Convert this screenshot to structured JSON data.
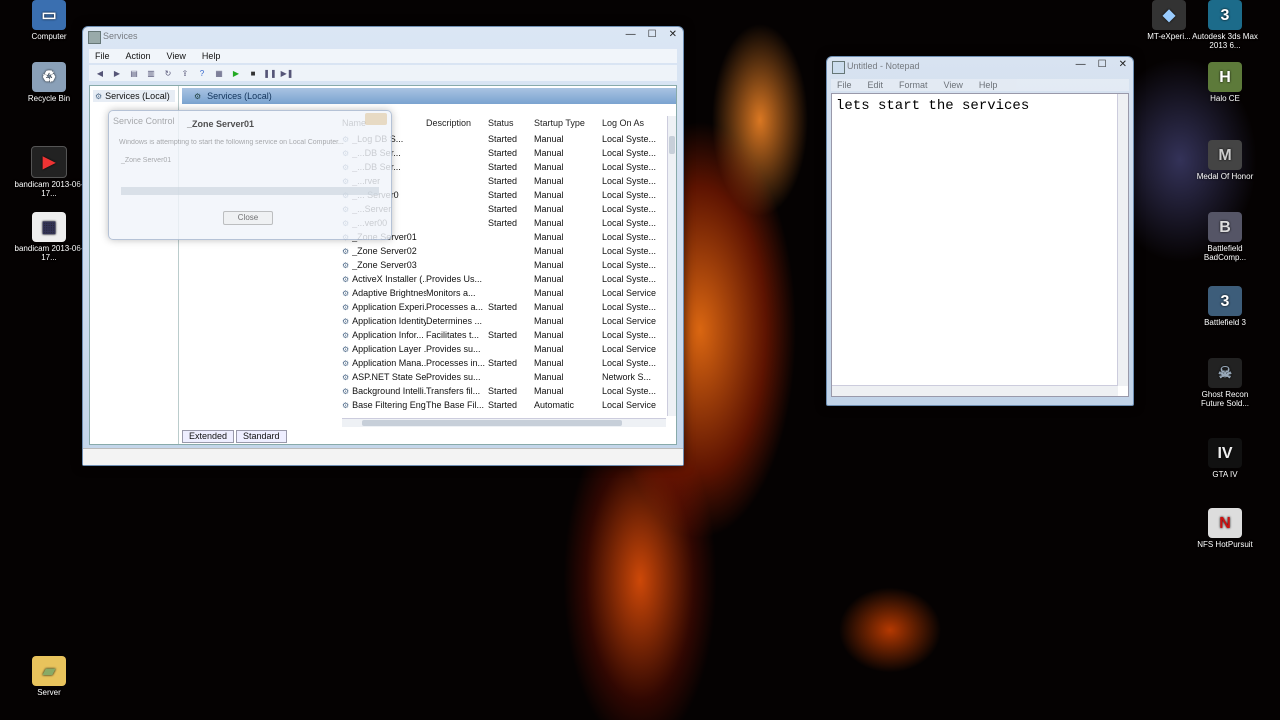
{
  "desktop": {
    "left_icons": [
      {
        "label": "Computer",
        "glyph": "▭",
        "name": "computer-icon"
      },
      {
        "label": "Recycle Bin",
        "glyph": "🗑",
        "name": "recycle-bin-icon"
      },
      {
        "label": "bandicam 2013-06-17...",
        "glyph": "▣",
        "name": "bandicam-video-icon"
      },
      {
        "label": "bandicam 2013-06-17...",
        "glyph": "▦",
        "name": "bandicam-avi-icon"
      },
      {
        "label": "Server",
        "glyph": "▰",
        "name": "folder-icon"
      }
    ],
    "right_icons": [
      {
        "label": "MT-eXperi...",
        "name": "mt-experience-icon"
      },
      {
        "label": "Autodesk 3ds Max 2013 6...",
        "name": "autodesk-3ds-max-icon"
      },
      {
        "label": "Halo CE",
        "name": "halo-ce-icon"
      },
      {
        "label": "Medal Of Honor",
        "name": "medal-of-honor-icon"
      },
      {
        "label": "Battlefield BadComp...",
        "name": "battlefield-bc-icon"
      },
      {
        "label": "Battlefield 3",
        "name": "battlefield-3-icon"
      },
      {
        "label": "Ghost Recon Future Sold...",
        "name": "ghost-recon-icon"
      },
      {
        "label": "GTA IV",
        "name": "gta-iv-icon"
      },
      {
        "label": "NFS HotPursuit",
        "name": "nfs-hot-pursuit-icon"
      }
    ]
  },
  "services": {
    "title": "Services",
    "controls": [
      "—",
      "☐",
      "✕"
    ],
    "menu": [
      "File",
      "Action",
      "View",
      "Help"
    ],
    "tree_item": "Services (Local)",
    "pane_title": "Services (Local)",
    "columns": {
      "name": "Name",
      "description": "Description",
      "status": "Status",
      "startup": "Startup Type",
      "logon": "Log On As"
    },
    "rows": [
      {
        "name": "_Log DB S...",
        "desc": "",
        "status": "Started",
        "startup": "Manual",
        "logon": "Local Syste..."
      },
      {
        "name": "_...DB Ser...",
        "desc": "",
        "status": "Started",
        "startup": "Manual",
        "logon": "Local Syste..."
      },
      {
        "name": "_...DB Ser...",
        "desc": "",
        "status": "Started",
        "startup": "Manual",
        "logon": "Local Syste..."
      },
      {
        "name": "_...rver",
        "desc": "",
        "status": "Started",
        "startup": "Manual",
        "logon": "Local Syste..."
      },
      {
        "name": "_... Server0",
        "desc": "",
        "status": "Started",
        "startup": "Manual",
        "logon": "Local Syste..."
      },
      {
        "name": "_...Server",
        "desc": "",
        "status": "Started",
        "startup": "Manual",
        "logon": "Local Syste..."
      },
      {
        "name": "_...ver00",
        "desc": "",
        "status": "Started",
        "startup": "Manual",
        "logon": "Local Syste..."
      },
      {
        "name": "_Zone Server01",
        "desc": "",
        "status": "",
        "startup": "Manual",
        "logon": "Local Syste..."
      },
      {
        "name": "_Zone Server02",
        "desc": "",
        "status": "",
        "startup": "Manual",
        "logon": "Local Syste..."
      },
      {
        "name": "_Zone Server03",
        "desc": "",
        "status": "",
        "startup": "Manual",
        "logon": "Local Syste..."
      },
      {
        "name": "ActiveX Installer (...",
        "desc": "Provides Us...",
        "status": "",
        "startup": "Manual",
        "logon": "Local Syste..."
      },
      {
        "name": "Adaptive Brightness",
        "desc": "Monitors a...",
        "status": "",
        "startup": "Manual",
        "logon": "Local Service"
      },
      {
        "name": "Application Experi...",
        "desc": "Processes a...",
        "status": "Started",
        "startup": "Manual",
        "logon": "Local Syste..."
      },
      {
        "name": "Application Identity",
        "desc": "Determines ...",
        "status": "",
        "startup": "Manual",
        "logon": "Local Service"
      },
      {
        "name": "Application Infor...",
        "desc": "Facilitates t...",
        "status": "Started",
        "startup": "Manual",
        "logon": "Local Syste..."
      },
      {
        "name": "Application Layer ...",
        "desc": "Provides su...",
        "status": "",
        "startup": "Manual",
        "logon": "Local Service"
      },
      {
        "name": "Application Mana...",
        "desc": "Processes in...",
        "status": "Started",
        "startup": "Manual",
        "logon": "Local Syste..."
      },
      {
        "name": "ASP.NET State Ser...",
        "desc": "Provides su...",
        "status": "",
        "startup": "Manual",
        "logon": "Network S..."
      },
      {
        "name": "Background Intelli...",
        "desc": "Transfers fil...",
        "status": "Started",
        "startup": "Manual",
        "logon": "Local Syste..."
      },
      {
        "name": "Base Filtering Engi...",
        "desc": "The Base Fil...",
        "status": "Started",
        "startup": "Automatic",
        "logon": "Local Service"
      }
    ],
    "tabs": [
      "Extended",
      "Standard"
    ]
  },
  "dialog": {
    "title": "Service Control",
    "service": "_Zone Server01",
    "message": "Windows is attempting to start the following service on Local Computer...",
    "service_line": "_Zone Server01",
    "close_label": "Close"
  },
  "notepad": {
    "title": "Untitled - Notepad",
    "menu": [
      "File",
      "Edit",
      "Format",
      "View",
      "Help"
    ],
    "content": "lets start the services"
  }
}
